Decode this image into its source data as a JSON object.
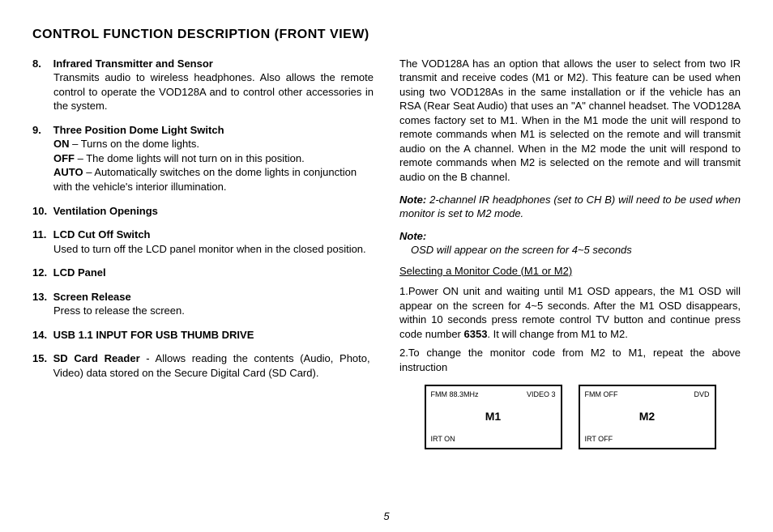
{
  "page_number": "5",
  "title": "CONTROL FUNCTION DESCRIPTION (FRONT VIEW)",
  "left": {
    "items": [
      {
        "num": "8.",
        "heading": "Infrared Transmitter and Sensor",
        "body": "Transmits audio to wireless headphones. Also allows the remote control to operate the VOD128A and to control other accessories in the system."
      },
      {
        "num": "9.",
        "heading": "Three Position Dome Light Switch",
        "lines": [
          {
            "label": "ON",
            "text": " – Turns on the dome lights."
          },
          {
            "label": "OFF",
            "text": " – The dome lights will not turn on in this position."
          },
          {
            "label": "AUTO",
            "text": " – Automatically switches on the dome lights in conjunction with the vehicle's interior illumination."
          }
        ]
      },
      {
        "num": "10.",
        "heading": "Ventilation Openings"
      },
      {
        "num": "11.",
        "heading": "LCD Cut Off Switch",
        "body": "Used to turn off the LCD panel monitor when in the closed position."
      },
      {
        "num": "12.",
        "heading": "LCD Panel"
      },
      {
        "num": "13.",
        "heading": "Screen Release",
        "body": "Press to release the screen."
      },
      {
        "num": "14.",
        "heading": "USB 1.1 INPUT FOR USB THUMB DRIVE"
      },
      {
        "num": "15.",
        "heading": "SD Card Reader",
        "inline_body": " - Allows reading the contents (Audio, Photo, Video) data stored on the Secure Digital Card (SD Card)."
      }
    ]
  },
  "right": {
    "intro": "The VOD128A has an option that allows the user to select from two IR transmit and receive codes (M1 or M2). This feature can be used when using two VOD128As in the same installation or if the vehicle has an RSA (Rear Seat Audio) that uses an \"A\" channel headset. The VOD128A comes factory set to M1. When in the M1 mode the unit will respond to remote commands when M1 is selected on the remote and will transmit audio on the A channel. When in the M2 mode the unit will respond to remote commands when M2 is selected on the remote and will transmit audio on the B channel.",
    "note1_label": "Note:",
    "note1_text": " 2-channel IR headphones (set to CH B) will need to be used when monitor is set to M2 mode.",
    "note2_label": "Note:",
    "note2_text": "OSD will appear on the screen for 4~5 seconds",
    "subheading": "Selecting a  Monitor Code (M1 or M2)",
    "step1_a": "1.Power ON unit and waiting until M1 OSD appears, the M1 OSD will appear on the screen for 4~5 seconds. After the M1 OSD disappears, within 10 seconds press remote control TV button and continue press code number ",
    "step1_code": "6353",
    "step1_b": ". It will change from M1 to M2.",
    "step2": "2.To change the monitor code from M2 to M1, repeat the above instruction",
    "osd": [
      {
        "tl": "FMM 88.3MHz",
        "tr": "VIDEO 3",
        "bl": "IRT ON",
        "center": "M1"
      },
      {
        "tl": "FMM OFF",
        "tr": "DVD",
        "bl": "IRT OFF",
        "center": "M2"
      }
    ]
  }
}
